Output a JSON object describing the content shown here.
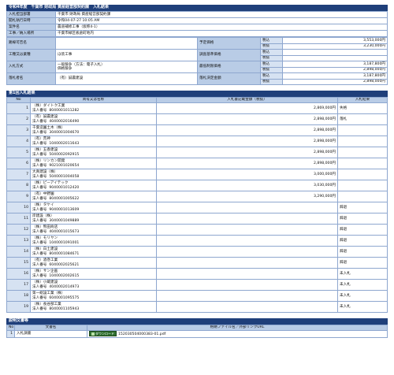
{
  "header": {
    "title": "令和4年度　千葉市 財政局 資産経営部契約課　入札結果"
  },
  "info": [
    {
      "label": "入札担当部署",
      "value": "千葉市 財政局 資産経営部契約課"
    },
    {
      "label": "開札執行日時",
      "value": "令和04-07-27 10:05 AM"
    },
    {
      "label": "案件名",
      "value": "農道補修工事（仮称4-1）"
    },
    {
      "label": "工事／納入場所",
      "value": "千葉市緑区板倉町地内"
    }
  ],
  "main": {
    "route_label": "路線可否名",
    "route_value": "",
    "type_label": "工種又は業種",
    "type_value": "ほ装工事",
    "method_label": "入札方式",
    "method_value": "一般競争（方法：電子入札）\n価格競争",
    "winner_label": "落札者名",
    "winner_value": "（有）誠農建設",
    "est_label": "予定価格",
    "survey_label": "調査基準価格",
    "min_label": "最低制限価格",
    "award_label": "落札決定金額",
    "tax_in": "税込",
    "tax_out": "税抜",
    "est_in": "3,553,000円",
    "est_out": "3,230,000円",
    "survey_in": "",
    "survey_out": "",
    "min_in": "3,187,800円",
    "min_out": "2,898,000円",
    "award_in": "3,187,800円",
    "award_out": "2,898,000円"
  },
  "bids": {
    "section_title": "第1回入札結果",
    "headers": {
      "no": "No",
      "name": "商号又は名称",
      "amount": "入札書記載金額（税抜）",
      "result": "入札結果"
    },
    "corp_prefix": "法人番号",
    "rows": [
      {
        "no": "1",
        "name": "（株）ダイトク工業",
        "corp": "8040001011282",
        "amount": "2,869,000円",
        "result": "失格"
      },
      {
        "no": "2",
        "name": "（有）誠農建設",
        "corp": "4040002016490",
        "amount": "2,898,000円",
        "result": "落札"
      },
      {
        "no": "3",
        "name": "千葉造園土木（株）",
        "corp": "3040001004670",
        "amount": "2,898,000円",
        "result": ""
      },
      {
        "no": "4",
        "name": "（有）荒神",
        "corp": "1040002011643",
        "amount": "2,898,000円",
        "result": ""
      },
      {
        "no": "5",
        "name": "（株）五香建設",
        "corp": "5040002092915",
        "amount": "2,898,000円",
        "result": ""
      },
      {
        "no": "6",
        "name": "（株）リンカン開発",
        "corp": "9021001020654",
        "amount": "2,898,000円",
        "result": ""
      },
      {
        "no": "7",
        "name": "大真建設（株）",
        "corp": "5040001004058",
        "amount": "3,000,000円",
        "result": ""
      },
      {
        "no": "8",
        "name": "（株）ピーアイテック",
        "corp": "9040001012420",
        "amount": "3,030,000円",
        "result": ""
      },
      {
        "no": "9",
        "name": "（有）中野園",
        "corp": "8040001005622",
        "amount": "3,290,000円",
        "result": ""
      },
      {
        "no": "10",
        "name": "（株）タケイ",
        "corp": "9040001013609",
        "amount": "",
        "result": "辞退"
      },
      {
        "no": "11",
        "name": "岸建設（株）",
        "corp": "3040001049889",
        "amount": "",
        "result": "辞退"
      },
      {
        "no": "12",
        "name": "（株）熊田商店",
        "corp": "4040001015673",
        "amount": "",
        "result": "辞退"
      },
      {
        "no": "13",
        "name": "（株）モリヤン",
        "corp": "1040001091001",
        "amount": "",
        "result": "辞退"
      },
      {
        "no": "14",
        "name": "（株）白土建設",
        "corp": "8040001084671",
        "amount": "",
        "result": "辞退"
      },
      {
        "no": "15",
        "name": "（有）酒巻工業",
        "corp": "6040002025621",
        "amount": "",
        "result": "辞退"
      },
      {
        "no": "16",
        "name": "（株）サン企画",
        "corp": "1040002002615",
        "amount": "",
        "result": "未入札"
      },
      {
        "no": "17",
        "name": "（株）小蔵建設",
        "corp": "4040002014973",
        "amount": "",
        "result": "未入札"
      },
      {
        "no": "18",
        "name": "第一総設工業（株）",
        "corp": "6040001095575",
        "amount": "",
        "result": "未入札"
      },
      {
        "no": "19",
        "name": "（株）長谷部工業",
        "corp": "8040001105943",
        "amount": "",
        "result": "未入札"
      }
    ]
  },
  "docs": {
    "section_title": "説明文書等",
    "headers": {
      "no": "No",
      "name": "文書名",
      "file": "格納ファイル名／外部リンクURL"
    },
    "download_label": "ダウンロード",
    "rows": [
      {
        "no": "1",
        "name": "入札調書",
        "file": "152030504000383-01.pdf"
      }
    ]
  },
  "colors": {
    "header_bg": "#1f3f7a",
    "label_bg": "#b9cce6",
    "border": "#8ea7cf",
    "download_bg": "#2f6e2f"
  }
}
